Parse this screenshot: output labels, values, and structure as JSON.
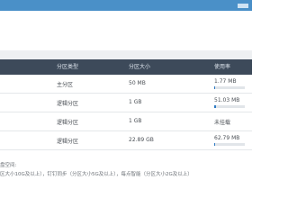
{
  "table": {
    "headers": {
      "type": "分区类型",
      "size": "分区大小",
      "usage": "使用率"
    },
    "rows": [
      {
        "type": "主分区",
        "size": "50 MB",
        "usage": "1.77 MB",
        "usage_fraction": 0.04,
        "has_bar": true
      },
      {
        "type": "逻辑分区",
        "size": "1 GB",
        "usage": "51.03 MB",
        "usage_fraction": 0.05,
        "has_bar": true
      },
      {
        "type": "逻辑分区",
        "size": "1 GB",
        "usage": "未挂载",
        "usage_fraction": 0,
        "has_bar": false
      },
      {
        "type": "逻辑分区",
        "size": "22.89 GB",
        "usage": "62.79 MB",
        "usage_fraction": 0.03,
        "has_bar": true
      }
    ]
  },
  "notes": {
    "line1": "盘空间:",
    "line2": "区大小10G及以上），钉钉同步（分区大小5G及以上），每点智能（分区大小2G及以上）"
  },
  "colors": {
    "topbar": "#4a90c8",
    "table_header": "#3d4a5a",
    "bar_fill": "#2e7bc4"
  }
}
